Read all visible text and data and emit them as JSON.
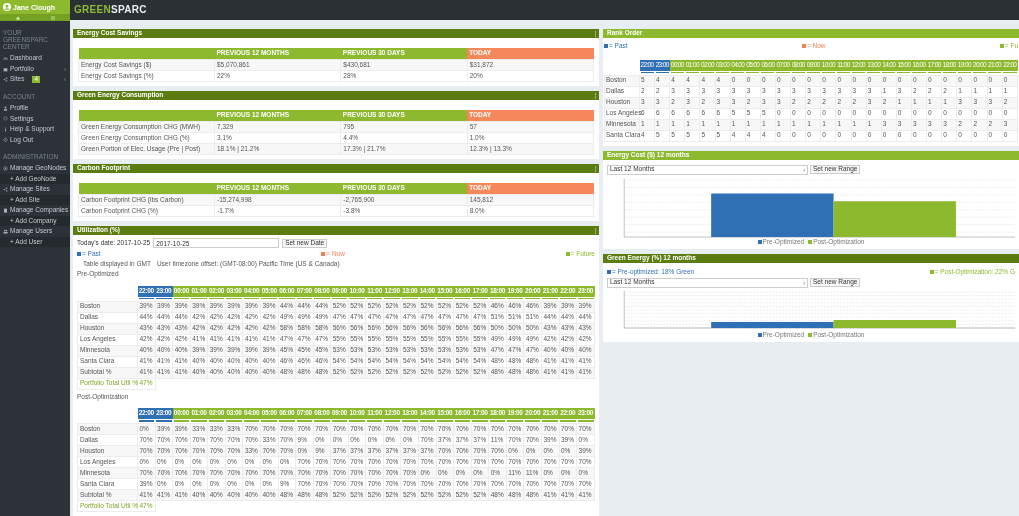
{
  "sidebar": {
    "user": "Jane Clough",
    "sections": [
      {
        "title": "YOUR GREENSPARC CENTER",
        "items": [
          {
            "label": "Dashboard"
          },
          {
            "label": "Portfolio",
            "expanded": false
          },
          {
            "label": "Sites",
            "badge": "4",
            "expanded": false
          }
        ]
      },
      {
        "title": "ACCOUNT",
        "items": [
          {
            "label": "Profile"
          },
          {
            "label": "Settings"
          },
          {
            "label": "Help & Support"
          },
          {
            "label": "Log Out"
          }
        ]
      },
      {
        "title": "ADMINISTRATION",
        "items": [
          {
            "label": "Manage GeoNodes",
            "children": [
              {
                "label": "+ Add GeoNode"
              }
            ]
          },
          {
            "label": "Manage Sites",
            "children": [
              {
                "label": "+ Add Site"
              }
            ]
          },
          {
            "label": "Manage Companies",
            "children": [
              {
                "label": "+ Add Company"
              }
            ]
          },
          {
            "label": "Manage Users",
            "children": [
              {
                "label": "+ Add User"
              }
            ]
          }
        ]
      }
    ]
  },
  "topbar": {
    "logo": {
      "accent": "GREEN",
      "rest": "SPARC"
    }
  },
  "summaries": [
    {
      "title": "Energy Cost Savings",
      "columns": [
        {
          "label": "PREVIOUS 12 MONTHS",
          "today": false
        },
        {
          "label": "PREVIOUS 30 DAYS",
          "today": false
        },
        {
          "label": "TODAY",
          "today": true
        }
      ],
      "rows": [
        {
          "label": "Energy Cost Savings ($)",
          "values": [
            "$5,070,861",
            "$430,681",
            "$31,872"
          ]
        },
        {
          "label": "Energy Cost Savings (%)",
          "values": [
            "22%",
            "28%",
            "20%"
          ]
        }
      ]
    },
    {
      "title": "Green Energy Consumption",
      "columns": [
        {
          "label": "PREVIOUS 12 MONTHS",
          "today": false
        },
        {
          "label": "PREVIOUS 30 DAYS",
          "today": false
        },
        {
          "label": "TODAY",
          "today": true
        }
      ],
      "rows": [
        {
          "label": "Green Energy Consumption CHG (MWH)",
          "values": [
            "7,329",
            "795",
            "57"
          ]
        },
        {
          "label": "Green Energy Consumption CHG (%)",
          "values": [
            "3.1%",
            "4.4%",
            "1.0%"
          ]
        },
        {
          "label": "Green Portion of Elec. Usage (Pre | Post)",
          "values": [
            "18.1% | 21.2%",
            "17.3% | 21.7%",
            "12.3% | 13.3%"
          ]
        }
      ]
    },
    {
      "title": "Carbon Footprint",
      "columns": [
        {
          "label": "PREVIOUS 12 MONTHS",
          "today": false
        },
        {
          "label": "PREVIOUS 30 DAYS",
          "today": false
        },
        {
          "label": "TODAY",
          "today": true
        }
      ],
      "rows": [
        {
          "label": "Carbon Footprint CHG (lbs Carbon)",
          "values": [
            "-15,274,998",
            "-2,765,900",
            "145,812"
          ]
        },
        {
          "label": "Carbon Footprint CHG (%)",
          "values": [
            "-1.7%",
            "-3.8%",
            "8.0%"
          ]
        }
      ]
    }
  ],
  "utilization": {
    "title": "Utilization (%)",
    "date_label": "Today's date: 2017-10-25",
    "date_value": "2017-10-25",
    "button": "Set new Date",
    "legend": [
      {
        "label": "= Past",
        "color": "#2f6fb3"
      },
      {
        "label": "= Now",
        "color": "#f08356"
      },
      {
        "label": "= Future",
        "color": "#8db92e"
      }
    ],
    "timezone": [
      "Table displayed in GMT",
      "User timezone offset: (GMT-08:00) Pacific Time (US & Canada)"
    ],
    "tables": [
      {
        "title": "Pre-Optimized",
        "columns": [
          {
            "label": "22:00",
            "kind": "past"
          },
          {
            "label": "23:00",
            "kind": "past"
          },
          {
            "label": "00:00",
            "kind": "future"
          },
          {
            "label": "01:00",
            "kind": "future"
          },
          {
            "label": "02:00",
            "kind": "future"
          },
          {
            "label": "03:00",
            "kind": "future"
          },
          {
            "label": "04:00",
            "kind": "future"
          },
          {
            "label": "05:00",
            "kind": "future"
          },
          {
            "label": "06:00",
            "kind": "future"
          },
          {
            "label": "07:00",
            "kind": "future"
          },
          {
            "label": "08:00",
            "kind": "future"
          },
          {
            "label": "09:00",
            "kind": "future"
          },
          {
            "label": "10:00",
            "kind": "future"
          },
          {
            "label": "11:00",
            "kind": "future"
          },
          {
            "label": "12:00",
            "kind": "future"
          },
          {
            "label": "13:00",
            "kind": "future"
          },
          {
            "label": "14:00",
            "kind": "future"
          },
          {
            "label": "15:00",
            "kind": "future"
          },
          {
            "label": "16:00",
            "kind": "future"
          },
          {
            "label": "17:00",
            "kind": "future"
          },
          {
            "label": "18:00",
            "kind": "future"
          },
          {
            "label": "19:00",
            "kind": "future"
          },
          {
            "label": "20:00",
            "kind": "future"
          },
          {
            "label": "21:00",
            "kind": "future"
          },
          {
            "label": "22:00",
            "kind": "future"
          },
          {
            "label": "23:00",
            "kind": "future"
          }
        ],
        "rows": [
          {
            "label": "Boston",
            "values": [
              "39%",
              "39%",
              "39%",
              "39%",
              "39%",
              "39%",
              "39%",
              "39%",
              "44%",
              "44%",
              "44%",
              "52%",
              "52%",
              "52%",
              "52%",
              "52%",
              "52%",
              "52%",
              "52%",
              "52%",
              "46%",
              "46%",
              "46%",
              "39%",
              "39%",
              "39%"
            ]
          },
          {
            "label": "Dallas",
            "values": [
              "44%",
              "44%",
              "44%",
              "42%",
              "42%",
              "42%",
              "42%",
              "42%",
              "49%",
              "49%",
              "49%",
              "47%",
              "47%",
              "47%",
              "47%",
              "47%",
              "47%",
              "47%",
              "47%",
              "47%",
              "51%",
              "51%",
              "51%",
              "44%",
              "44%",
              "44%"
            ]
          },
          {
            "label": "Houston",
            "values": [
              "43%",
              "43%",
              "43%",
              "42%",
              "42%",
              "42%",
              "42%",
              "42%",
              "58%",
              "58%",
              "58%",
              "56%",
              "56%",
              "56%",
              "56%",
              "56%",
              "56%",
              "56%",
              "56%",
              "56%",
              "50%",
              "50%",
              "50%",
              "43%",
              "43%",
              "43%"
            ]
          },
          {
            "label": "Los Angeles",
            "values": [
              "42%",
              "42%",
              "42%",
              "41%",
              "41%",
              "41%",
              "41%",
              "41%",
              "47%",
              "47%",
              "47%",
              "55%",
              "55%",
              "55%",
              "55%",
              "55%",
              "55%",
              "55%",
              "55%",
              "55%",
              "49%",
              "49%",
              "49%",
              "42%",
              "42%",
              "42%"
            ]
          },
          {
            "label": "Minnesota",
            "values": [
              "40%",
              "40%",
              "40%",
              "39%",
              "39%",
              "39%",
              "39%",
              "39%",
              "45%",
              "45%",
              "45%",
              "53%",
              "53%",
              "53%",
              "53%",
              "53%",
              "53%",
              "53%",
              "53%",
              "53%",
              "47%",
              "47%",
              "47%",
              "40%",
              "40%",
              "40%"
            ]
          },
          {
            "label": "Santa Clara",
            "values": [
              "41%",
              "41%",
              "41%",
              "40%",
              "40%",
              "40%",
              "40%",
              "40%",
              "46%",
              "46%",
              "46%",
              "54%",
              "54%",
              "54%",
              "54%",
              "54%",
              "54%",
              "54%",
              "54%",
              "54%",
              "48%",
              "48%",
              "48%",
              "41%",
              "41%",
              "41%"
            ]
          },
          {
            "label": "Subtotal %",
            "values": [
              "41%",
              "41%",
              "41%",
              "40%",
              "40%",
              "40%",
              "40%",
              "40%",
              "48%",
              "48%",
              "48%",
              "52%",
              "52%",
              "52%",
              "52%",
              "52%",
              "52%",
              "52%",
              "52%",
              "52%",
              "48%",
              "48%",
              "48%",
              "41%",
              "41%",
              "41%"
            ]
          }
        ],
        "total": {
          "label": "Portfolio Total Util %",
          "value": "47%"
        }
      },
      {
        "title": "Post-Optimization",
        "columns": [
          {
            "label": "22:00",
            "kind": "past"
          },
          {
            "label": "23:00",
            "kind": "past"
          },
          {
            "label": "00:00",
            "kind": "future"
          },
          {
            "label": "01:00",
            "kind": "future"
          },
          {
            "label": "02:00",
            "kind": "future"
          },
          {
            "label": "03:00",
            "kind": "future"
          },
          {
            "label": "04:00",
            "kind": "future"
          },
          {
            "label": "05:00",
            "kind": "future"
          },
          {
            "label": "06:00",
            "kind": "future"
          },
          {
            "label": "07:00",
            "kind": "future"
          },
          {
            "label": "08:00",
            "kind": "future"
          },
          {
            "label": "09:00",
            "kind": "future"
          },
          {
            "label": "10:00",
            "kind": "future"
          },
          {
            "label": "11:00",
            "kind": "future"
          },
          {
            "label": "12:00",
            "kind": "future"
          },
          {
            "label": "13:00",
            "kind": "future"
          },
          {
            "label": "14:00",
            "kind": "future"
          },
          {
            "label": "15:00",
            "kind": "future"
          },
          {
            "label": "16:00",
            "kind": "future"
          },
          {
            "label": "17:00",
            "kind": "future"
          },
          {
            "label": "18:00",
            "kind": "future"
          },
          {
            "label": "19:00",
            "kind": "future"
          },
          {
            "label": "20:00",
            "kind": "future"
          },
          {
            "label": "21:00",
            "kind": "future"
          },
          {
            "label": "22:00",
            "kind": "future"
          },
          {
            "label": "23:00",
            "kind": "future"
          }
        ],
        "rows": [
          {
            "label": "Boston",
            "values": [
              "0%",
              "39%",
              "39%",
              "33%",
              "33%",
              "33%",
              "70%",
              "70%",
              "70%",
              "70%",
              "70%",
              "70%",
              "70%",
              "70%",
              "70%",
              "70%",
              "70%",
              "70%",
              "70%",
              "70%",
              "70%",
              "70%",
              "70%",
              "70%",
              "70%",
              "70%"
            ]
          },
          {
            "label": "Dallas",
            "values": [
              "70%",
              "70%",
              "70%",
              "70%",
              "70%",
              "70%",
              "70%",
              "33%",
              "70%",
              "9%",
              "0%",
              "0%",
              "0%",
              "0%",
              "0%",
              "0%",
              "70%",
              "37%",
              "37%",
              "37%",
              "11%",
              "70%",
              "70%",
              "39%",
              "39%",
              "0%"
            ]
          },
          {
            "label": "Houston",
            "values": [
              "70%",
              "70%",
              "70%",
              "70%",
              "70%",
              "70%",
              "33%",
              "70%",
              "70%",
              "0%",
              "9%",
              "37%",
              "37%",
              "37%",
              "37%",
              "37%",
              "37%",
              "70%",
              "70%",
              "70%",
              "70%",
              "0%",
              "0%",
              "0%",
              "0%",
              "39%"
            ]
          },
          {
            "label": "Los Angeles",
            "values": [
              "0%",
              "0%",
              "0%",
              "0%",
              "0%",
              "0%",
              "0%",
              "0%",
              "0%",
              "70%",
              "70%",
              "70%",
              "70%",
              "70%",
              "70%",
              "70%",
              "70%",
              "70%",
              "70%",
              "70%",
              "70%",
              "70%",
              "70%",
              "70%",
              "70%",
              "70%"
            ]
          },
          {
            "label": "Minnesota",
            "values": [
              "70%",
              "70%",
              "70%",
              "70%",
              "70%",
              "70%",
              "70%",
              "70%",
              "70%",
              "70%",
              "70%",
              "70%",
              "70%",
              "70%",
              "70%",
              "70%",
              "0%",
              "0%",
              "0%",
              "0%",
              "0%",
              "11%",
              "11%",
              "0%",
              "0%",
              "0%"
            ]
          },
          {
            "label": "Santa Clara",
            "values": [
              "39%",
              "0%",
              "0%",
              "0%",
              "0%",
              "0%",
              "0%",
              "0%",
              "9%",
              "70%",
              "70%",
              "70%",
              "70%",
              "70%",
              "70%",
              "70%",
              "70%",
              "70%",
              "70%",
              "70%",
              "70%",
              "70%",
              "70%",
              "70%",
              "70%",
              "70%"
            ]
          },
          {
            "label": "Subtotal %",
            "values": [
              "41%",
              "41%",
              "41%",
              "40%",
              "40%",
              "40%",
              "40%",
              "40%",
              "48%",
              "48%",
              "48%",
              "52%",
              "52%",
              "52%",
              "52%",
              "52%",
              "52%",
              "52%",
              "52%",
              "52%",
              "48%",
              "48%",
              "48%",
              "41%",
              "41%",
              "41%"
            ]
          }
        ],
        "total": {
          "label": "Portfolio Total Util %",
          "value": "47%"
        }
      }
    ]
  },
  "rank_order": {
    "title": "Rank Order",
    "legend": [
      {
        "label": "= Past",
        "color": "#2f6fb3"
      },
      {
        "label": "= Now",
        "color": "#f08356"
      },
      {
        "label": "= Fu",
        "color": "#8db92e"
      }
    ],
    "columns": [
      {
        "label": "22:00",
        "kind": "past"
      },
      {
        "label": "23:00",
        "kind": "past"
      },
      {
        "label": "00:00",
        "kind": "future"
      },
      {
        "label": "01:00",
        "kind": "future"
      },
      {
        "label": "02:00",
        "kind": "future"
      },
      {
        "label": "03:00",
        "kind": "future"
      },
      {
        "label": "04:00",
        "kind": "future"
      },
      {
        "label": "05:00",
        "kind": "future"
      },
      {
        "label": "06:00",
        "kind": "future"
      },
      {
        "label": "07:00",
        "kind": "future"
      },
      {
        "label": "08:00",
        "kind": "future"
      },
      {
        "label": "09:00",
        "kind": "future"
      },
      {
        "label": "10:00",
        "kind": "future"
      },
      {
        "label": "11:00",
        "kind": "future"
      },
      {
        "label": "12:00",
        "kind": "future"
      },
      {
        "label": "13:00",
        "kind": "future"
      },
      {
        "label": "14:00",
        "kind": "future"
      },
      {
        "label": "15:00",
        "kind": "future"
      },
      {
        "label": "16:00",
        "kind": "future"
      },
      {
        "label": "17:00",
        "kind": "future"
      },
      {
        "label": "18:00",
        "kind": "future"
      },
      {
        "label": "19:00",
        "kind": "future"
      },
      {
        "label": "20:00",
        "kind": "future"
      },
      {
        "label": "21:00",
        "kind": "future"
      },
      {
        "label": "22:00",
        "kind": "future"
      }
    ],
    "rows": [
      {
        "label": "Boston",
        "values": [
          "5",
          "4",
          "4",
          "4",
          "4",
          "4",
          "0",
          "0",
          "0",
          "0",
          "0",
          "0",
          "0",
          "0",
          "0",
          "0",
          "0",
          "0",
          "0",
          "0",
          "0",
          "0",
          "0",
          "0",
          "0"
        ]
      },
      {
        "label": "Dallas",
        "values": [
          "2",
          "2",
          "3",
          "3",
          "3",
          "3",
          "3",
          "3",
          "3",
          "3",
          "3",
          "3",
          "3",
          "3",
          "3",
          "3",
          "1",
          "3",
          "2",
          "2",
          "2",
          "1",
          "1",
          "1",
          "1"
        ]
      },
      {
        "label": "Houston",
        "values": [
          "3",
          "3",
          "2",
          "3",
          "2",
          "3",
          "3",
          "2",
          "3",
          "3",
          "2",
          "2",
          "2",
          "2",
          "2",
          "3",
          "2",
          "1",
          "1",
          "1",
          "1",
          "3",
          "3",
          "3",
          "2"
        ]
      },
      {
        "label": "Los Angeles",
        "values": [
          "6",
          "6",
          "6",
          "6",
          "6",
          "6",
          "5",
          "5",
          "5",
          "0",
          "0",
          "0",
          "0",
          "0",
          "0",
          "0",
          "0",
          "0",
          "0",
          "0",
          "0",
          "0",
          "0",
          "0",
          "0"
        ]
      },
      {
        "label": "Minnesota",
        "values": [
          "1",
          "1",
          "1",
          "1",
          "1",
          "1",
          "1",
          "1",
          "1",
          "1",
          "1",
          "1",
          "1",
          "1",
          "1",
          "1",
          "3",
          "3",
          "3",
          "3",
          "3",
          "2",
          "2",
          "2",
          "3"
        ]
      },
      {
        "label": "Santa Clara",
        "values": [
          "4",
          "5",
          "5",
          "5",
          "5",
          "5",
          "4",
          "4",
          "4",
          "0",
          "0",
          "0",
          "0",
          "0",
          "0",
          "0",
          "0",
          "0",
          "0",
          "0",
          "0",
          "0",
          "0",
          "0",
          "0"
        ]
      }
    ]
  },
  "charts": [
    {
      "title": "Energy Cost ($) 12 months",
      "range": "Last 12 Months",
      "button": "Set new Range",
      "kind": "cost",
      "legend": [
        {
          "label": "Pre-Optimized",
          "color": "#2f6fb3"
        },
        {
          "label": "Post-Optimization",
          "color": "#8db92e"
        }
      ]
    },
    {
      "title": "Green Energy (%) 12 months",
      "range": "Last 12 Months",
      "button": "Set new Range",
      "kind": "green",
      "top_legend": [
        {
          "label": "= Pre-optimized: 18% Green",
          "color": "#2f6fb3"
        },
        {
          "label": "= Post-Optimization: 22% G",
          "color": "#8db92e"
        }
      ],
      "legend": [
        {
          "label": "Pre-Optimized",
          "color": "#2f6fb3"
        },
        {
          "label": "Post-Optimization",
          "color": "#8db92e"
        }
      ]
    }
  ]
}
